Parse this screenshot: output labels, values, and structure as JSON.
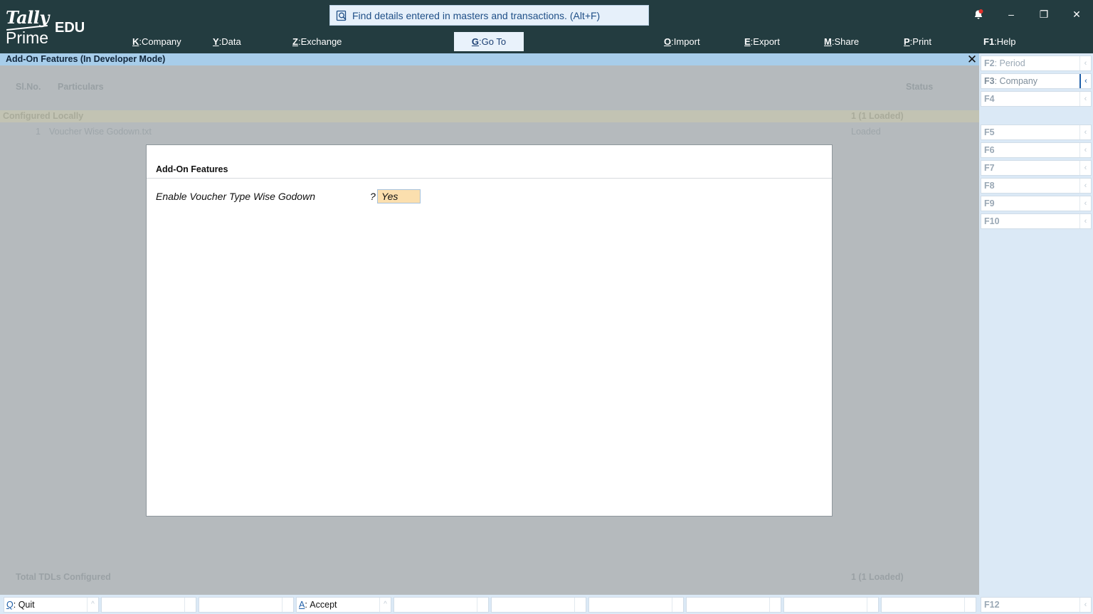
{
  "app": {
    "logo_tally": "Tally",
    "logo_prime": "Prime",
    "edition": "EDU"
  },
  "search": {
    "placeholder": "Find details entered in masters and transactions. (Alt+F)"
  },
  "menu": [
    {
      "key": "K",
      "label": "Company"
    },
    {
      "key": "Y",
      "label": "Data"
    },
    {
      "key": "Z",
      "label": "Exchange"
    },
    {
      "key": "G",
      "label": "Go To"
    },
    {
      "key": "O",
      "label": "Import"
    },
    {
      "key": "E",
      "label": "Export"
    },
    {
      "key": "M",
      "label": "Share"
    },
    {
      "key": "P",
      "label": "Print"
    },
    {
      "key": "F1",
      "label": "Help"
    }
  ],
  "window_controls": {
    "minimize": "–",
    "restore": "❐",
    "close": "✕"
  },
  "screen_title": "Add-On Features (In Developer Mode)",
  "report": {
    "col_slno": "Sl.No.",
    "col_particulars": "Particulars",
    "col_status": "Status",
    "group_name": "Configured Locally",
    "group_count": "1 (1 Loaded)",
    "item_no": "1",
    "item_name": "Voucher Wise Godown.txt",
    "item_status": "Loaded",
    "total_label": "Total TDLs Configured",
    "total_value": "1 (1 Loaded)"
  },
  "dialog": {
    "title": "Add-On Features",
    "field_label": "Enable Voucher Type Wise Godown",
    "field_q": "?",
    "field_value": "Yes"
  },
  "right_panel": [
    {
      "key": "F2",
      "label": "Period"
    },
    {
      "key": "F3",
      "label": "Company"
    },
    {
      "key": "F4",
      "label": ""
    },
    {
      "key": "F5",
      "label": ""
    },
    {
      "key": "F6",
      "label": ""
    },
    {
      "key": "F7",
      "label": ""
    },
    {
      "key": "F8",
      "label": ""
    },
    {
      "key": "F9",
      "label": ""
    },
    {
      "key": "F10",
      "label": ""
    },
    {
      "key": "F12",
      "label": ""
    }
  ],
  "bottom_bar": {
    "quit_key": "Q",
    "quit_label": "Quit",
    "accept_key": "A",
    "accept_label": "Accept"
  },
  "colors": {
    "topbar": "#233c40",
    "title_bar": "#a7cdea",
    "field_highlight": "#fbdfae",
    "panel": "#dbe9f6"
  }
}
